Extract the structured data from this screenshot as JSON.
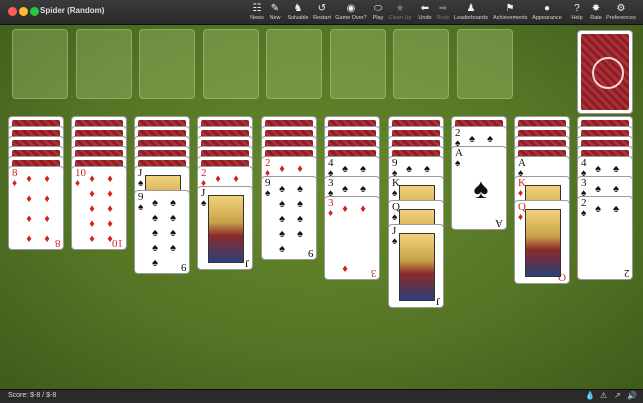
{
  "window": {
    "title": "Spider (Random)"
  },
  "toolbar": {
    "items": [
      {
        "label": "News",
        "icon": "☷",
        "enabled": true
      },
      {
        "label": "New",
        "icon": "✎",
        "enabled": true
      },
      {
        "label": "Solvable",
        "icon": "♞",
        "enabled": true
      },
      {
        "label": "Restart",
        "icon": "↺",
        "enabled": true
      },
      {
        "label": "Game Over?",
        "icon": "◉",
        "enabled": true
      },
      {
        "label": "Play",
        "icon": "⬭",
        "enabled": true
      },
      {
        "label": "Clean Up",
        "icon": "★",
        "enabled": false
      },
      {
        "label": "Undo",
        "icon": "⬅",
        "enabled": true
      },
      {
        "label": "Redo",
        "icon": "➡",
        "enabled": false
      },
      {
        "label": "Leaderboards",
        "icon": "♟",
        "enabled": true
      },
      {
        "label": "Achievements",
        "icon": "⚑",
        "enabled": true
      },
      {
        "label": "Appearance",
        "icon": "●",
        "enabled": true
      },
      {
        "label": "Help",
        "icon": "?",
        "enabled": true
      },
      {
        "label": "Rate",
        "icon": "✸",
        "enabled": true
      },
      {
        "label": "Preferences",
        "icon": "⚙",
        "enabled": true
      }
    ]
  },
  "board": {
    "foundation_count": 8,
    "stock": {
      "pile": "stock",
      "face": "down"
    },
    "tableau": [
      {
        "hidden": 5,
        "cards": [
          {
            "rank": "8",
            "suit": "♦",
            "color": "red"
          }
        ]
      },
      {
        "hidden": 5,
        "cards": [
          {
            "rank": "10",
            "suit": "♦",
            "color": "red"
          }
        ]
      },
      {
        "hidden": 5,
        "cards": [
          {
            "rank": "J",
            "suit": "♠",
            "color": "black"
          },
          {
            "rank": "9",
            "suit": "♠",
            "color": "black"
          }
        ]
      },
      {
        "hidden": 5,
        "cards": [
          {
            "rank": "2",
            "suit": "♦",
            "color": "red"
          },
          {
            "rank": "J",
            "suit": "♠",
            "color": "black"
          }
        ]
      },
      {
        "hidden": 4,
        "cards": [
          {
            "rank": "2",
            "suit": "♦",
            "color": "red"
          },
          {
            "rank": "9",
            "suit": "♠",
            "color": "black"
          }
        ]
      },
      {
        "hidden": 4,
        "cards": [
          {
            "rank": "4",
            "suit": "♠",
            "color": "black"
          },
          {
            "rank": "3",
            "suit": "♠",
            "color": "black"
          },
          {
            "rank": "3",
            "suit": "♦",
            "color": "red"
          }
        ]
      },
      {
        "hidden": 4,
        "cards": [
          {
            "rank": "9",
            "suit": "♠",
            "color": "black"
          },
          {
            "rank": "K",
            "suit": "♠",
            "color": "black"
          },
          {
            "rank": "Q",
            "suit": "♠",
            "color": "black"
          },
          {
            "rank": "J",
            "suit": "♠",
            "color": "black"
          }
        ]
      },
      {
        "hidden": 1,
        "cards": [
          {
            "rank": "2",
            "suit": "♠",
            "color": "black"
          },
          {
            "rank": "A",
            "suit": "♠",
            "color": "black"
          }
        ]
      },
      {
        "hidden": 4,
        "cards": [
          {
            "rank": "A",
            "suit": "♠",
            "color": "black"
          },
          {
            "rank": "K",
            "suit": "♦",
            "color": "red"
          },
          {
            "rank": "Q",
            "suit": "♦",
            "color": "red"
          }
        ]
      },
      {
        "hidden": 4,
        "cards": [
          {
            "rank": "4",
            "suit": "♠",
            "color": "black"
          },
          {
            "rank": "3",
            "suit": "♠",
            "color": "black"
          },
          {
            "rank": "2",
            "suit": "♠",
            "color": "black"
          }
        ]
      }
    ]
  },
  "status": {
    "score": "Score: $-8 / $-8"
  }
}
